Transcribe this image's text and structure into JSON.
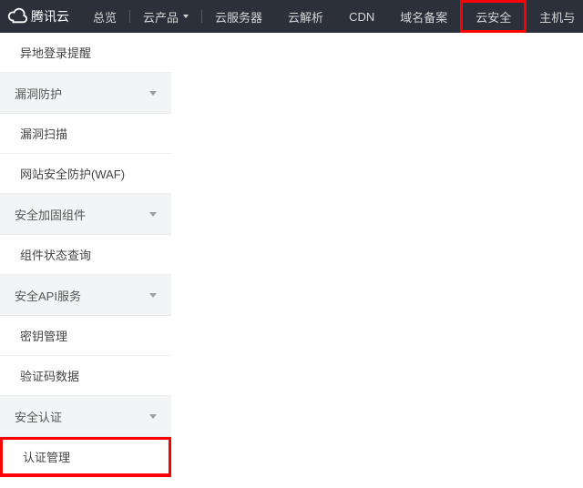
{
  "brand": {
    "name": "腾讯云"
  },
  "nav": {
    "overview": "总览",
    "cloud_products": "云产品",
    "cloud_server": "云服务器",
    "cloud_dns": "云解析",
    "cdn": "CDN",
    "domain_beian": "域名备案",
    "cloud_security": "云安全",
    "host_partial": "主机与"
  },
  "sidebar": {
    "item_remote_login_alert": "异地登录提醒",
    "group_vuln_protection": "漏洞防护",
    "item_vuln_scan": "漏洞扫描",
    "item_waf": "网站安全防护(WAF)",
    "group_security_harden": "安全加固组件",
    "item_component_status": "组件状态查询",
    "group_security_api": "安全API服务",
    "item_key_mgmt": "密钥管理",
    "item_captcha_data": "验证码数据",
    "group_security_auth": "安全认证",
    "item_cert_mgmt": "认证管理"
  }
}
